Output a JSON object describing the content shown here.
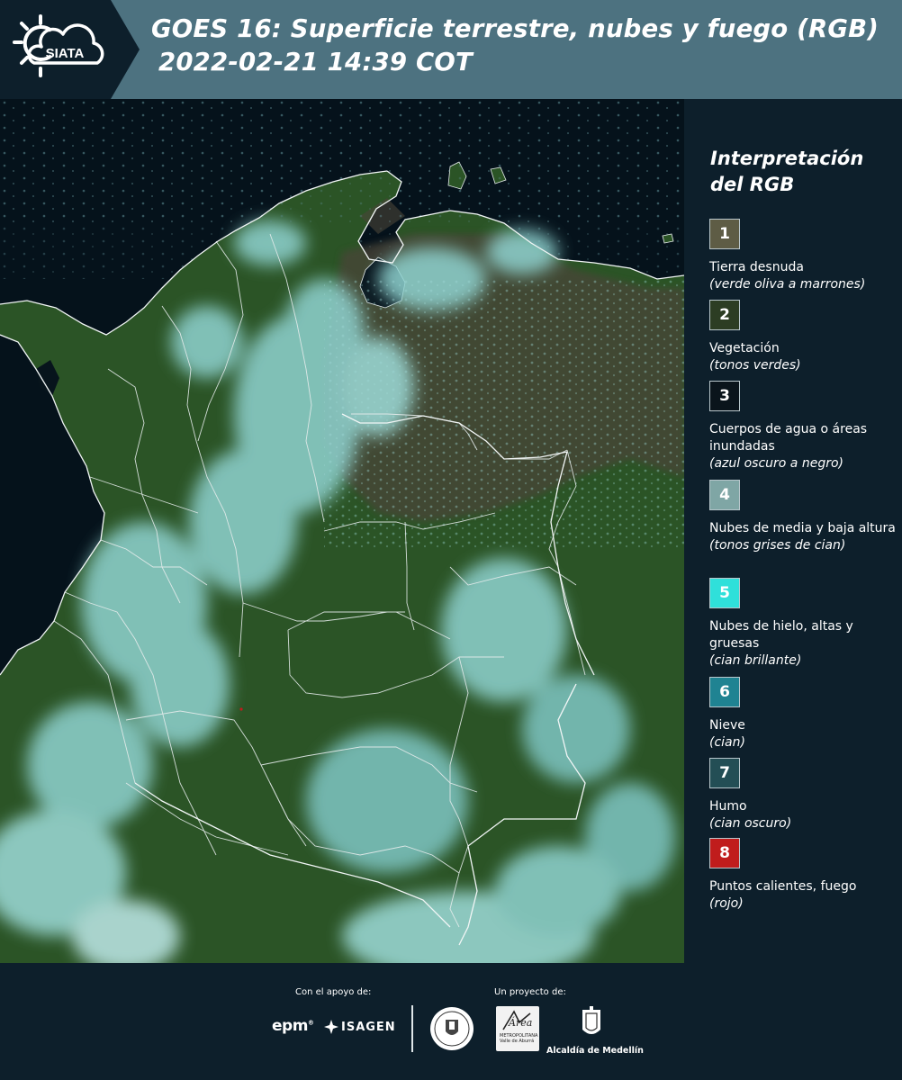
{
  "header": {
    "logo_text": "SIATA",
    "title_line1": "GOES 16: Superficie terrestre, nubes y fuego (RGB)",
    "title_line2": "2022-02-21 14:39 COT"
  },
  "legend": {
    "title_line1": "Interpretación",
    "title_line2": "del RGB",
    "items": [
      {
        "number": "1",
        "label": "Tierra desnuda",
        "description": "(verde oliva a marrones)",
        "color": "#5e5c45"
      },
      {
        "number": "2",
        "label": "Vegetación",
        "description": "(tonos verdes)",
        "color": "#2c3d23"
      },
      {
        "number": "3",
        "label": "Cuerpos de agua o áreas inundadas",
        "description": "(azul oscuro a negro)",
        "color": "#0a141b"
      },
      {
        "number": "4",
        "label": "Nubes de media y baja altura",
        "description": "(tonos grises de cian)",
        "color": "#7fa6a5"
      },
      {
        "number": "5",
        "label": "Nubes de hielo, altas y gruesas",
        "description": "(cian brillante)",
        "color": "#2fe0da"
      },
      {
        "number": "6",
        "label": "Nieve",
        "description": "(cian)",
        "color": "#1f8392"
      },
      {
        "number": "7",
        "label": "Humo",
        "description": "(cian oscuro)",
        "color": "#234e55"
      },
      {
        "number": "8",
        "label": "Puntos calientes, fuego",
        "description": "(rojo)",
        "color": "#c01c1c"
      }
    ]
  },
  "footer": {
    "support_label": "Con el apoyo de:",
    "project_label": "Un proyecto de:",
    "epm": "epm",
    "isagen": "ISAGEN",
    "area_logo_text": "Área",
    "area_logo_subtext": "METROPOLITANA Valle de Aburrá",
    "alcaldia": "Alcaldía de Medellín"
  },
  "colors": {
    "background": "#0d1f2b",
    "header_band": "#4d7280",
    "ocean": "#05121b",
    "vegetation": "#2f5a26",
    "bare_soil": "#4a4538",
    "clouds": "#7ecfcf",
    "borders": "#e6ecec"
  }
}
